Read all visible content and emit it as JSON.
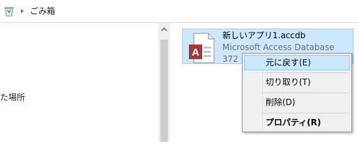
{
  "address_bar": {
    "location_icon": "recycle-bin-icon",
    "separator_icon": "chevron-right-icon",
    "location": "ごみ箱"
  },
  "navigation_pane": {
    "partial_item": "た場所"
  },
  "file": {
    "name": "新しいアプリ1.accdb",
    "type": "Microsoft Access Database",
    "size_partial": "372 K",
    "icon": "access-database-icon",
    "icon_letter": "A",
    "selected": true
  },
  "context_menu": {
    "items": [
      {
        "label": "元に戻す(E)",
        "highlighted": true,
        "bold": false
      },
      {
        "label": "切り取り(T)",
        "highlighted": false,
        "bold": false
      },
      {
        "label": "削除(D)",
        "highlighted": false,
        "bold": false
      },
      {
        "label": "プロパティ(R)",
        "highlighted": false,
        "bold": true
      }
    ]
  },
  "colors": {
    "selection_fill": "#cce8ff",
    "selection_border": "#99d1ff",
    "access_red": "#a4373a"
  }
}
